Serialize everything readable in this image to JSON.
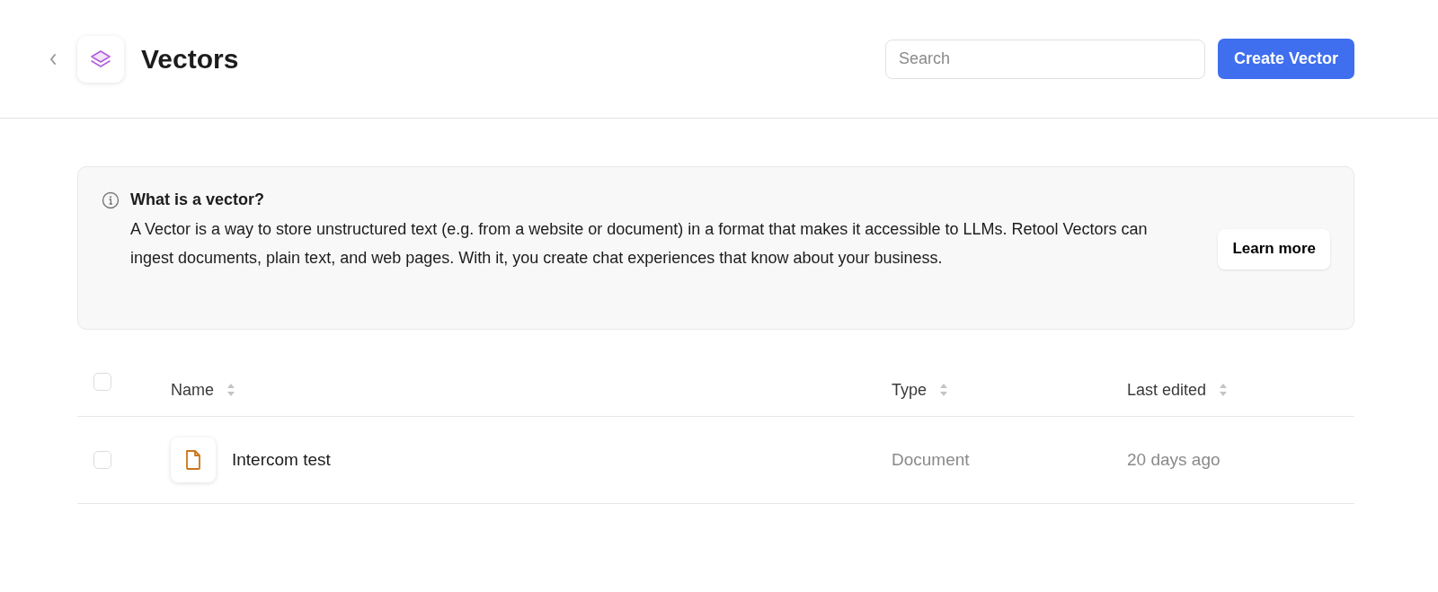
{
  "header": {
    "title": "Vectors",
    "search": {
      "placeholder": "Search"
    },
    "create_button": "Create Vector"
  },
  "info": {
    "title": "What is a vector?",
    "body": "A Vector is a way to store unstructured text (e.g. from a website or document) in a format that makes it accessible to LLMs. Retool Vectors can ingest documents, plain text, and web pages. With it, you create chat experiences that know about your business.",
    "button": "Learn more"
  },
  "table": {
    "select_all": {
      "checked": false
    },
    "columns": [
      "Name",
      "Type",
      "Last edited"
    ],
    "rows": [
      {
        "checked": false,
        "name": "Intercom test",
        "type": "Document",
        "last_edited": "20 days ago"
      }
    ]
  }
}
